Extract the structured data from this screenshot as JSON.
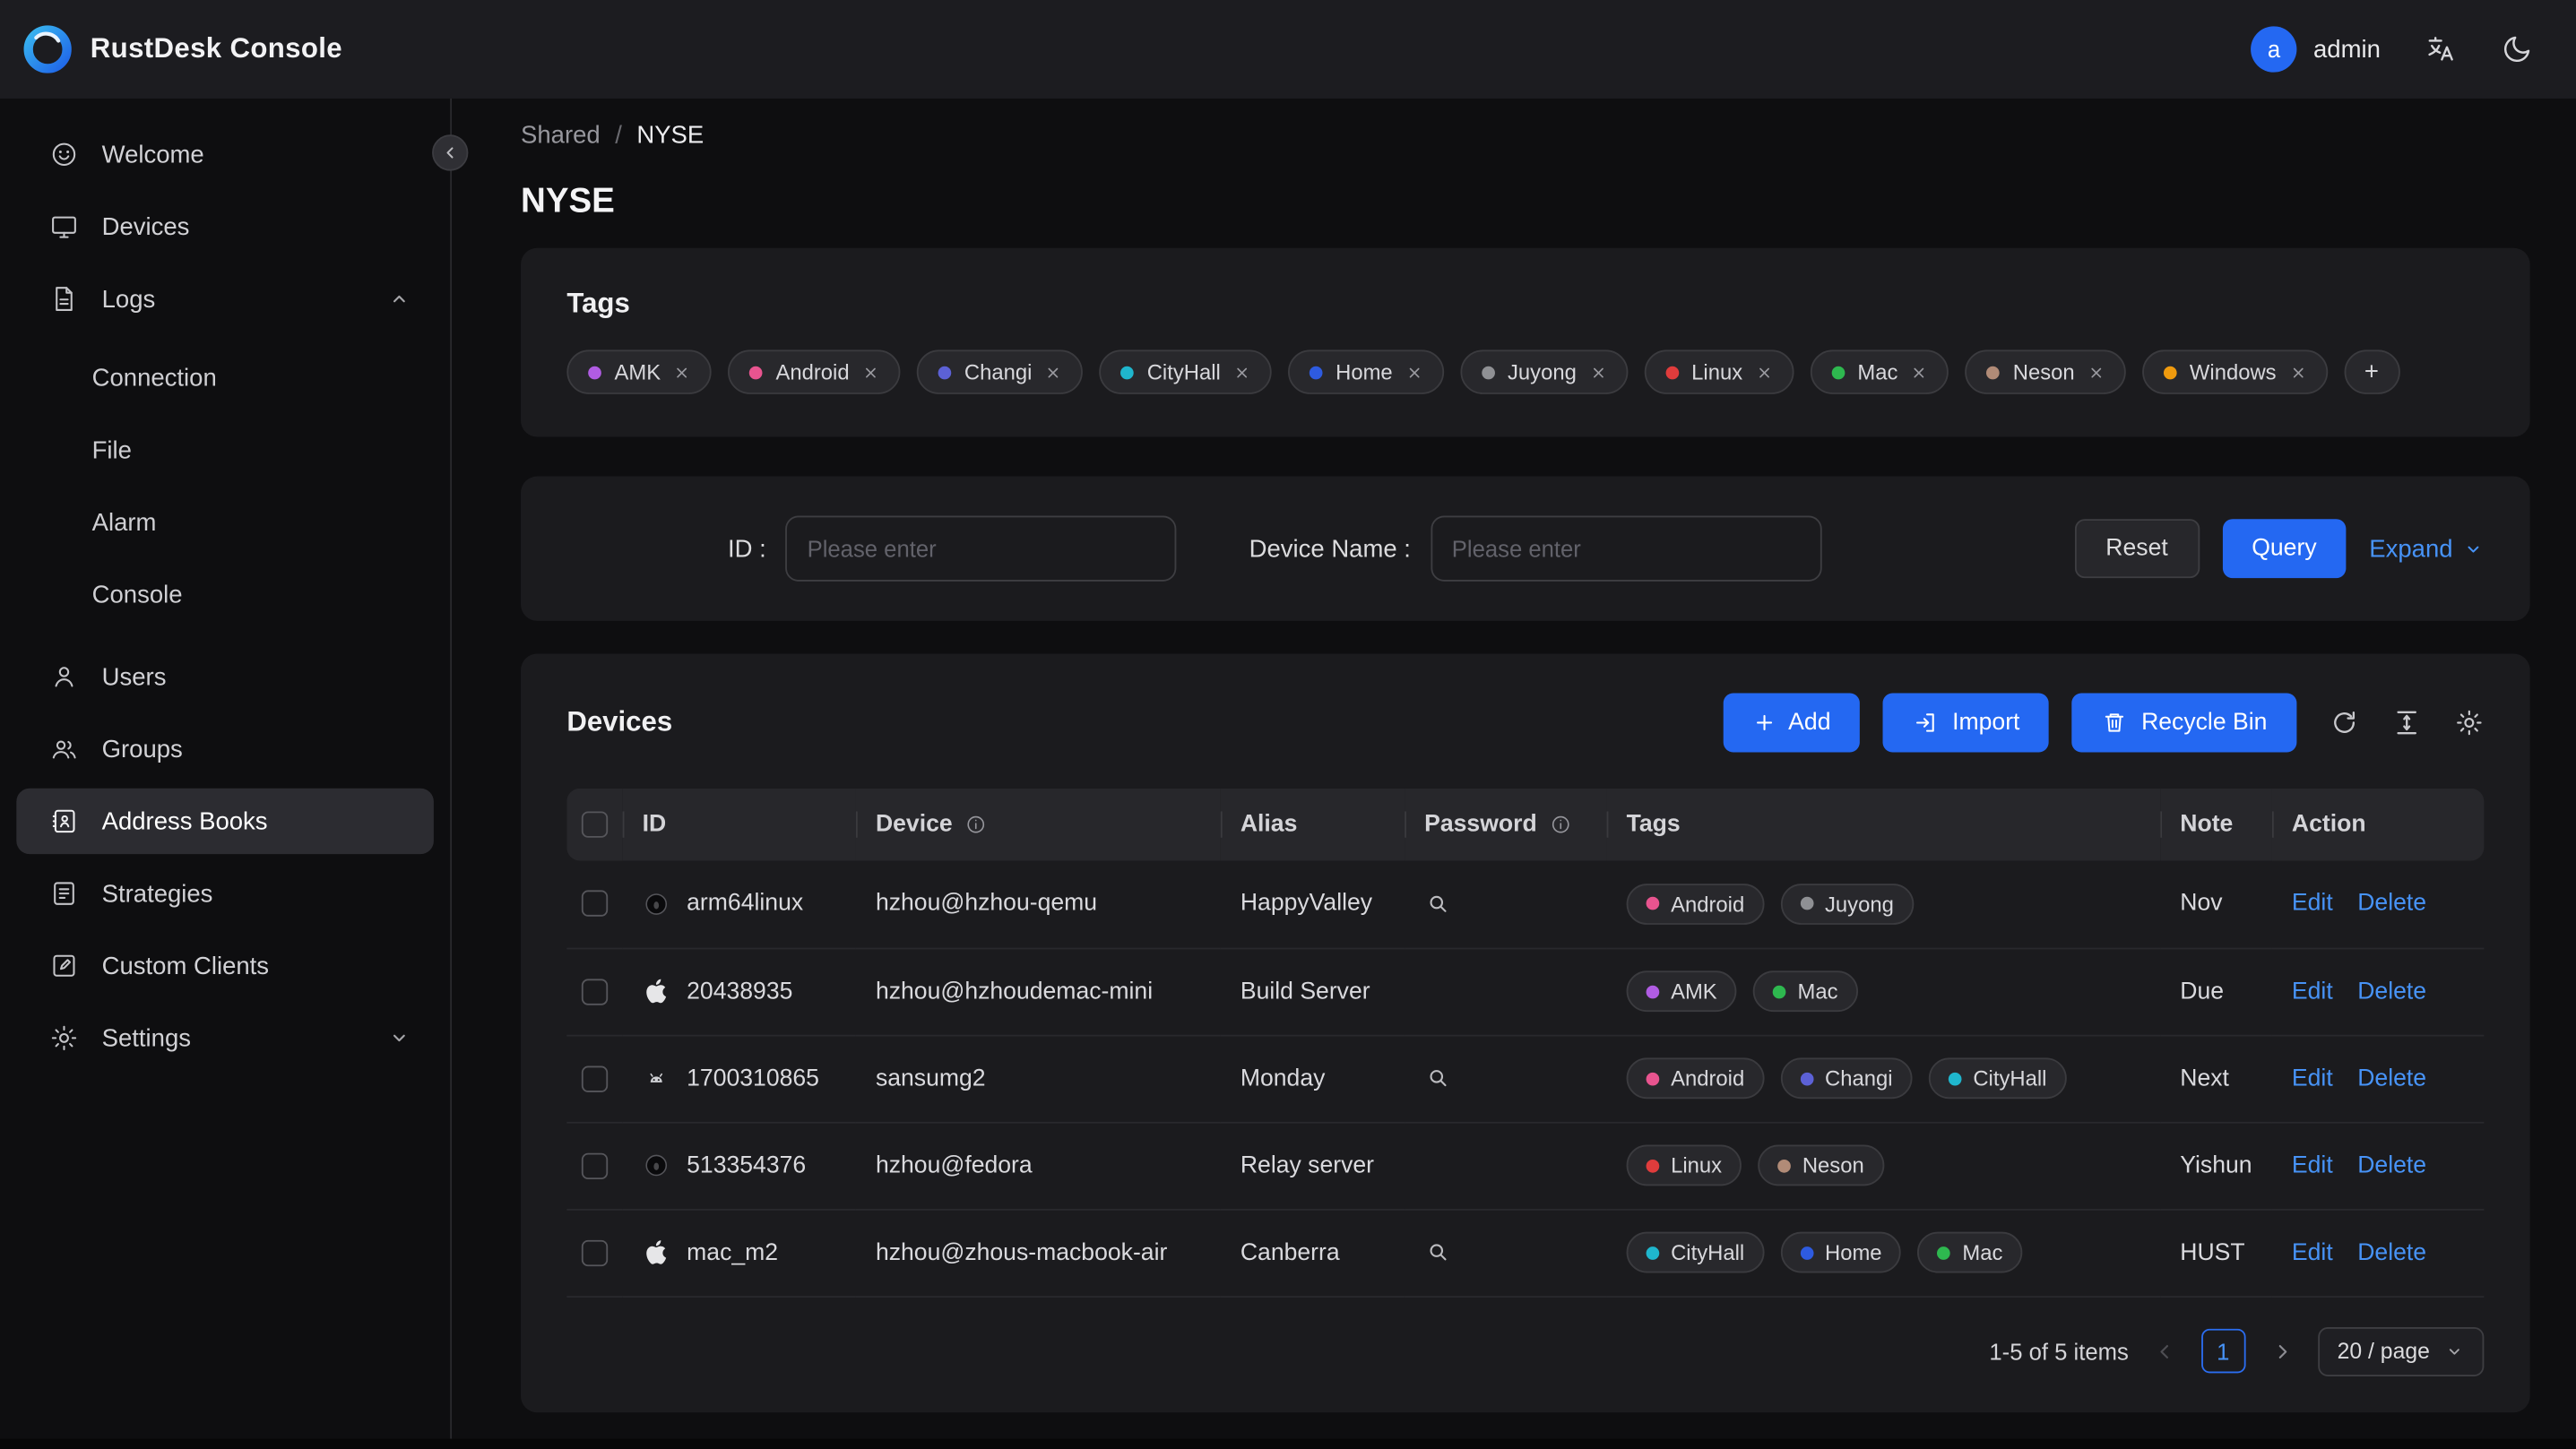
{
  "colors": {
    "primary": "#2468f2",
    "link": "#4793f7"
  },
  "header": {
    "app_title": "RustDesk Console",
    "user_initial": "a",
    "username": "admin"
  },
  "sidebar": {
    "items": [
      {
        "label": "Welcome"
      },
      {
        "label": "Devices"
      },
      {
        "label": "Logs"
      },
      {
        "label": "Users"
      },
      {
        "label": "Groups"
      },
      {
        "label": "Address Books"
      },
      {
        "label": "Strategies"
      },
      {
        "label": "Custom Clients"
      },
      {
        "label": "Settings"
      }
    ],
    "logs_children": [
      {
        "label": "Connection"
      },
      {
        "label": "File"
      },
      {
        "label": "Alarm"
      },
      {
        "label": "Console"
      }
    ]
  },
  "breadcrumb": {
    "parent": "Shared",
    "separator": "/",
    "current": "NYSE"
  },
  "page_title": "NYSE",
  "tags_card": {
    "title": "Tags",
    "add_button": "+",
    "tags": [
      {
        "label": "AMK",
        "color": "#b05ce3"
      },
      {
        "label": "Android",
        "color": "#e8548f"
      },
      {
        "label": "Changi",
        "color": "#5c61d6"
      },
      {
        "label": "CityHall",
        "color": "#1fb6cd"
      },
      {
        "label": "Home",
        "color": "#2e5be0"
      },
      {
        "label": "Juyong",
        "color": "#8f9094"
      },
      {
        "label": "Linux",
        "color": "#e03c3c"
      },
      {
        "label": "Mac",
        "color": "#2eb84f"
      },
      {
        "label": "Neson",
        "color": "#b18b77"
      },
      {
        "label": "Windows",
        "color": "#ef9a0e"
      }
    ]
  },
  "filter": {
    "id_label": "ID :",
    "id_placeholder": "Please enter",
    "device_name_label": "Device Name :",
    "device_name_placeholder": "Please enter",
    "reset_button": "Reset",
    "query_button": "Query",
    "expand_button": "Expand"
  },
  "devices_card": {
    "title": "Devices",
    "add_button": "Add",
    "import_button": "Import",
    "recycle_bin_button": "Recycle Bin",
    "table": {
      "columns": {
        "id": "ID",
        "device": "Device",
        "alias": "Alias",
        "password": "Password",
        "tags": "Tags",
        "note": "Note",
        "action": "Action"
      },
      "edit_label": "Edit",
      "delete_label": "Delete",
      "rows": [
        {
          "os": "linux",
          "id": "arm64linux",
          "device": "hzhou@hzhou-qemu",
          "alias": "HappyValley",
          "has_password": true,
          "note": "Nov",
          "tags": [
            {
              "label": "Android",
              "color": "#e8548f"
            },
            {
              "label": "Juyong",
              "color": "#8f9094"
            }
          ]
        },
        {
          "os": "apple",
          "id": "20438935",
          "device": "hzhou@hzhoudemac-mini",
          "alias": "Build Server",
          "has_password": false,
          "note": "Due",
          "tags": [
            {
              "label": "AMK",
              "color": "#b05ce3"
            },
            {
              "label": "Mac",
              "color": "#2eb84f"
            }
          ]
        },
        {
          "os": "android",
          "id": "1700310865",
          "device": "sansumg2",
          "alias": "Monday",
          "has_password": true,
          "note": "Next",
          "tags": [
            {
              "label": "Android",
              "color": "#e8548f"
            },
            {
              "label": "Changi",
              "color": "#5c61d6"
            },
            {
              "label": "CityHall",
              "color": "#1fb6cd"
            }
          ]
        },
        {
          "os": "linux",
          "id": "513354376",
          "device": "hzhou@fedora",
          "alias": "Relay server",
          "has_password": false,
          "note": "Yishun",
          "tags": [
            {
              "label": "Linux",
              "color": "#e03c3c"
            },
            {
              "label": "Neson",
              "color": "#b18b77"
            }
          ]
        },
        {
          "os": "apple",
          "id": "mac_m2",
          "device": "hzhou@zhous-macbook-air",
          "alias": "Canberra",
          "has_password": true,
          "note": "HUST",
          "tags": [
            {
              "label": "CityHall",
              "color": "#1fb6cd"
            },
            {
              "label": "Home",
              "color": "#2e5be0"
            },
            {
              "label": "Mac",
              "color": "#2eb84f"
            }
          ]
        }
      ]
    },
    "pagination": {
      "summary": "1-5 of 5 items",
      "current_page": "1",
      "page_size": "20 / page"
    }
  }
}
